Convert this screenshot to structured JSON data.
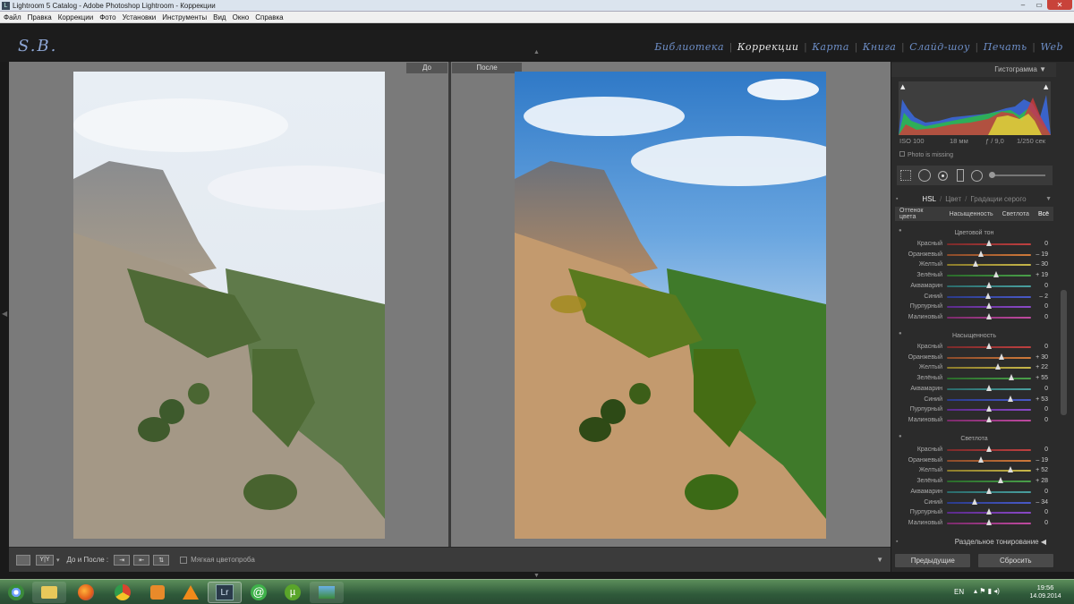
{
  "window": {
    "title": "Lightroom 5 Catalog - Adobe Photoshop Lightroom - Коррекции",
    "icon_letter": "L",
    "controls": [
      "–",
      "▭",
      "✕"
    ]
  },
  "menu": [
    "Файл",
    "Правка",
    "Коррекции",
    "Фото",
    "Установки",
    "Инструменты",
    "Вид",
    "Окно",
    "Справка"
  ],
  "identity_plate": "S.B.",
  "modules": [
    {
      "label": "Библиотека",
      "active": false
    },
    {
      "label": "Коррекции",
      "active": true
    },
    {
      "label": "Карта",
      "active": false
    },
    {
      "label": "Книга",
      "active": false
    },
    {
      "label": "Слайд-шоу",
      "active": false
    },
    {
      "label": "Печать",
      "active": false
    },
    {
      "label": "Web",
      "active": false
    }
  ],
  "compare": {
    "before_label": "До",
    "after_label": "После"
  },
  "toolbar": {
    "before_after_label": "До и После :",
    "soft_proof_label": "Мягкая цветопроба",
    "view_icon_label": "Y|Y"
  },
  "panel": {
    "histogram_title": "Гистограмма",
    "iso": "ISO 100",
    "focal": "18 мм",
    "aperture": "ƒ / 9,0",
    "shutter": "1/250 сек",
    "photo_missing": "Photo is missing",
    "hsl_tabs": {
      "hsl": "HSL",
      "sep1": "/",
      "color": "Цвет",
      "sep2": "/",
      "gray": "Градации серого"
    },
    "sub_tabs": [
      "Оттенок цвета",
      "Насыщенность",
      "Светлота",
      "Всё"
    ],
    "sections": [
      {
        "title": "Цветовой тон",
        "rows": [
          {
            "label": "Красный",
            "value": "0"
          },
          {
            "label": "Оранжевый",
            "value": "– 19"
          },
          {
            "label": "Желтый",
            "value": "– 30"
          },
          {
            "label": "Зелёный",
            "value": "+ 19"
          },
          {
            "label": "Аквамарин",
            "value": "0"
          },
          {
            "label": "Синий",
            "value": "– 2"
          },
          {
            "label": "Пурпурный",
            "value": "0"
          },
          {
            "label": "Малиновый",
            "value": "0"
          }
        ]
      },
      {
        "title": "Насыщенность",
        "rows": [
          {
            "label": "Красный",
            "value": "0"
          },
          {
            "label": "Оранжевый",
            "value": "+ 30"
          },
          {
            "label": "Желтый",
            "value": "+ 22"
          },
          {
            "label": "Зелёный",
            "value": "+ 55"
          },
          {
            "label": "Аквамарин",
            "value": "0"
          },
          {
            "label": "Синий",
            "value": "+ 53"
          },
          {
            "label": "Пурпурный",
            "value": "0"
          },
          {
            "label": "Малиновый",
            "value": "0"
          }
        ]
      },
      {
        "title": "Светлота",
        "rows": [
          {
            "label": "Красный",
            "value": "0"
          },
          {
            "label": "Оранжевый",
            "value": "– 19"
          },
          {
            "label": "Желтый",
            "value": "+ 52"
          },
          {
            "label": "Зелёный",
            "value": "+ 28"
          },
          {
            "label": "Аквамарин",
            "value": "0"
          },
          {
            "label": "Синий",
            "value": "– 34"
          },
          {
            "label": "Пурпурный",
            "value": "0"
          },
          {
            "label": "Малиновый",
            "value": "0"
          }
        ]
      }
    ],
    "split_toning": "Раздельное тонирование",
    "prev_button": "Предыдущие",
    "reset_button": "Сбросить"
  },
  "taskbar": {
    "lang": "EN",
    "time": "19:56",
    "date": "14.09.2014"
  },
  "colors": {
    "accent": "#6e8fc8",
    "panel": "#2b2b2b",
    "workspace": "#7a7a7a"
  }
}
